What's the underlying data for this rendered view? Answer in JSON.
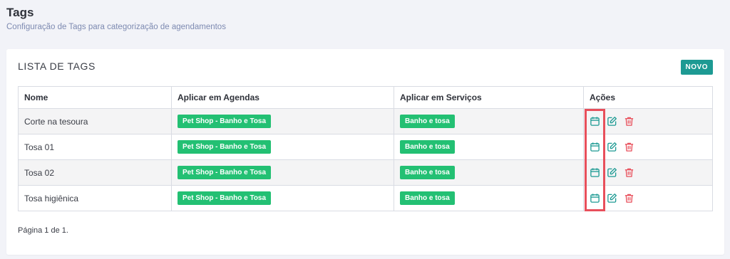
{
  "header": {
    "title": "Tags",
    "subtitle": "Configuração de Tags para categorização de agendamentos"
  },
  "card": {
    "title": "LISTA DE TAGS",
    "new_button": "NOVO"
  },
  "table": {
    "columns": [
      "Nome",
      "Aplicar em Agendas",
      "Aplicar em Serviços",
      "Ações"
    ],
    "rows": [
      {
        "nome": "Corte na tesoura",
        "agenda": "Pet Shop - Banho e Tosa",
        "servico": "Banho e tosa"
      },
      {
        "nome": "Tosa 01",
        "agenda": "Pet Shop - Banho e Tosa",
        "servico": "Banho e tosa"
      },
      {
        "nome": "Tosa 02",
        "agenda": "Pet Shop - Banho e Tosa",
        "servico": "Banho e tosa"
      },
      {
        "nome": "Tosa higiênica",
        "agenda": "Pet Shop - Banho e Tosa",
        "servico": "Banho e tosa"
      }
    ],
    "row_actions": [
      "calendar-icon",
      "edit-icon",
      "trash-icon"
    ]
  },
  "pagination": {
    "text": "Página 1 de 1."
  },
  "colors": {
    "accent": "#1d9a93",
    "badge": "#23c073",
    "delete": "#e84f5b",
    "highlight": "#e84f5b"
  }
}
